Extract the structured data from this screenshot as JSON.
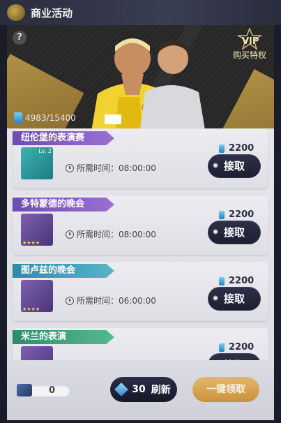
{
  "window": {
    "title": "商业活动"
  },
  "banner": {
    "help_label": "?",
    "vip_label": "VIP",
    "vip_text": "购买特权",
    "gauge_text": "4983/15400"
  },
  "events": [
    {
      "name": "纽伦堡的表演赛",
      "time_label": "所需时间：08:00:00",
      "cost": "2200",
      "button": "接取",
      "tag_color": "purple",
      "thumb_level": "Lv. 2"
    },
    {
      "name": "多特蒙德的晚会",
      "time_label": "所需时间：08:00:00",
      "cost": "2200",
      "button": "接取",
      "tag_color": "purple",
      "thumb_stars": "★★★★"
    },
    {
      "name": "图卢兹的晚会",
      "time_label": "所需时间：06:00:00",
      "cost": "2200",
      "button": "接取",
      "tag_color": "teal",
      "thumb_stars": "★★★★"
    },
    {
      "name": "米兰的表演",
      "cost": "2200",
      "button": "接取",
      "tag_color": "green"
    }
  ],
  "footer": {
    "ticket_count": "0",
    "refresh_cost": "30",
    "refresh_label": "刷新",
    "claim_all_label": "一键领取"
  }
}
